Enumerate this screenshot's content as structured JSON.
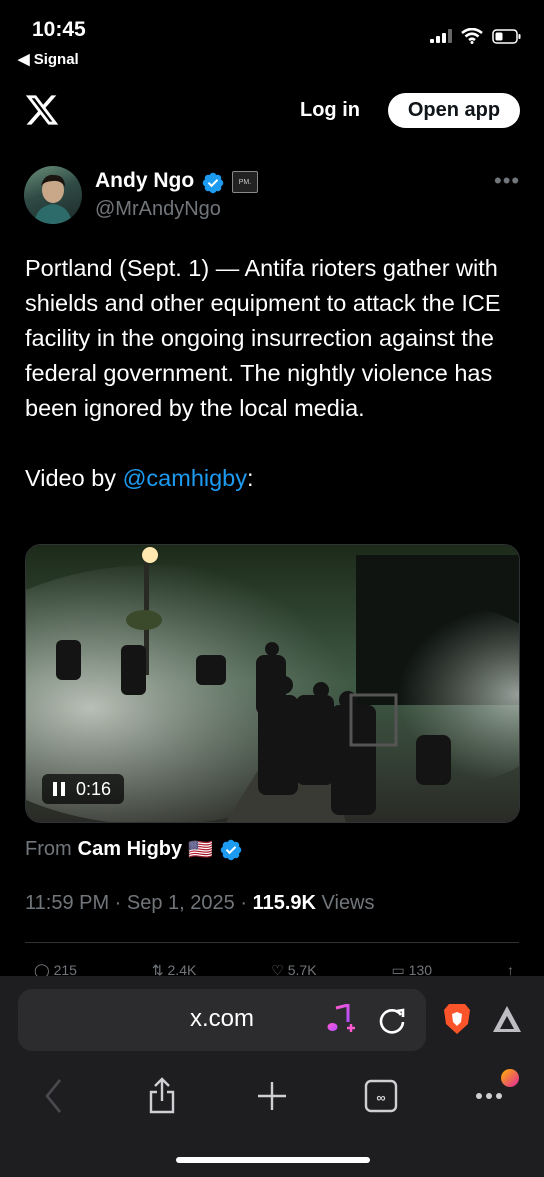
{
  "status_bar": {
    "time": "10:45",
    "back_label": "◀ Signal"
  },
  "header": {
    "login_label": "Log in",
    "open_app_label": "Open app"
  },
  "author": {
    "name": "Andy Ngo",
    "handle": "@MrAndyNgo",
    "badge": "PM."
  },
  "tweet": {
    "text_main": "Portland (Sept. 1) — Antifa rioters gather with shields and other equipment to attack the ICE facility in the ongoing insurrection against the federal government. The nightly violence has been ignored by the local media.",
    "video_by_prefix": "Video by ",
    "video_by_mention": "@camhigby",
    "video_by_suffix": ":"
  },
  "video": {
    "time": "0:16"
  },
  "attribution": {
    "from_label": "From",
    "name": "Cam Higby",
    "flag": "🇺🇸"
  },
  "meta": {
    "time": "11:59 PM",
    "date": "Sep 1, 2025",
    "views_count": "115.9K",
    "views_label": "Views"
  },
  "actions": {
    "replies": "215",
    "reposts": "2.4K",
    "likes": "5.7K",
    "bookmarks": "130"
  },
  "browser": {
    "url": "x.com"
  },
  "colors": {
    "accent": "#1d9bf0",
    "background": "#000000",
    "muted": "#71767b"
  }
}
